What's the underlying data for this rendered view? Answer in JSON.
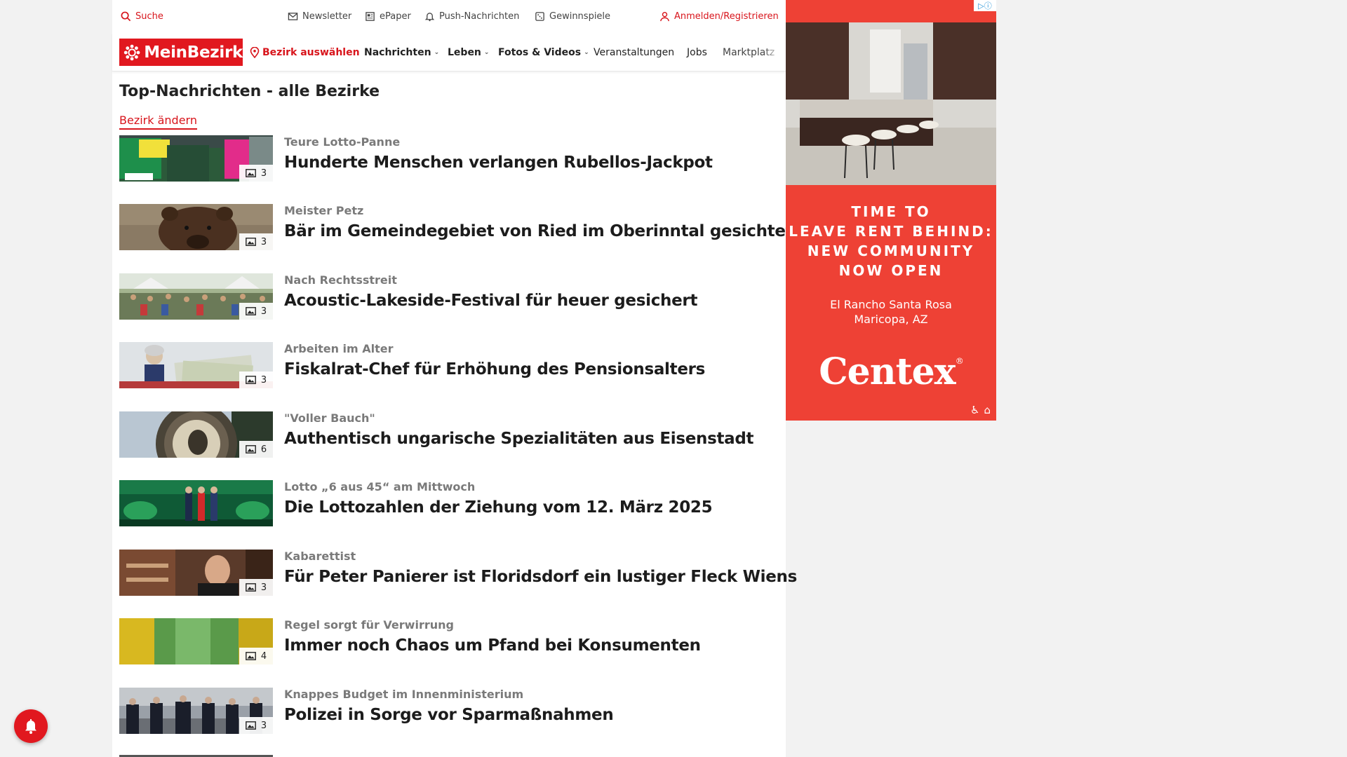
{
  "utility_bar": {
    "search": "Suche",
    "newsletter": "Newsletter",
    "epaper": "ePaper",
    "push": "Push-Nachrichten",
    "games": "Gewinnspiele",
    "login": "Anmelden/Registrieren"
  },
  "nav": {
    "logo": "MeinBezirk",
    "select_district": "Bezirk auswählen",
    "items": [
      "Nachrichten",
      "Leben",
      "Fotos & Videos",
      "Veranstaltungen",
      "Jobs",
      "Marktplatz"
    ]
  },
  "main": {
    "title": "Top-Nachrichten - alle Bezirke",
    "change_district": "Bezirk ändern",
    "articles": [
      {
        "kicker": "Teure Lotto-Panne",
        "headline": "Hunderte Menschen verlangen Rubellos-Jackpot",
        "images": "3"
      },
      {
        "kicker": "Meister Petz",
        "headline": "Bär im Gemeindegebiet von Ried im Oberinntal gesichtet",
        "images": "3"
      },
      {
        "kicker": "Nach Rechtsstreit",
        "headline": "Acoustic-Lakeside-Festival für heuer gesichert",
        "images": "3"
      },
      {
        "kicker": "Arbeiten im Alter",
        "headline": "Fiskalrat-Chef für Erhöhung des Pensionsalters",
        "images": "3"
      },
      {
        "kicker": "\"Voller Bauch\"",
        "headline": "Authentisch ungarische Spezialitäten aus Eisenstadt",
        "images": "6"
      },
      {
        "kicker": "Lotto „6 aus 45“ am Mittwoch",
        "headline": "Die Lottozahlen der Ziehung vom 12. März 2025",
        "images": ""
      },
      {
        "kicker": "Kabarettist",
        "headline": "Für Peter Panierer ist Floridsdorf ein lustiger Fleck Wiens",
        "images": "3"
      },
      {
        "kicker": "Regel sorgt für Verwirrung",
        "headline": "Immer noch Chaos um Pfand bei Konsumenten",
        "images": "4"
      },
      {
        "kicker": "Knappes Budget im Innenministerium",
        "headline": "Polizei in Sorge vor Sparmaßnahmen",
        "images": "3"
      }
    ]
  },
  "ad": {
    "headline_lines": [
      "TIME TO",
      "LEAVE RENT BEHIND:",
      "NEW COMMUNITY",
      "NOW OPEN"
    ],
    "location_lines": [
      "El Rancho Santa Rosa",
      "Maricopa, AZ"
    ],
    "brand": "Centex",
    "brand_mark": "®"
  },
  "colors": {
    "brand_red": "#e1181f",
    "ad_red": "#ee4135",
    "kicker_grey": "#7a7a7a"
  }
}
